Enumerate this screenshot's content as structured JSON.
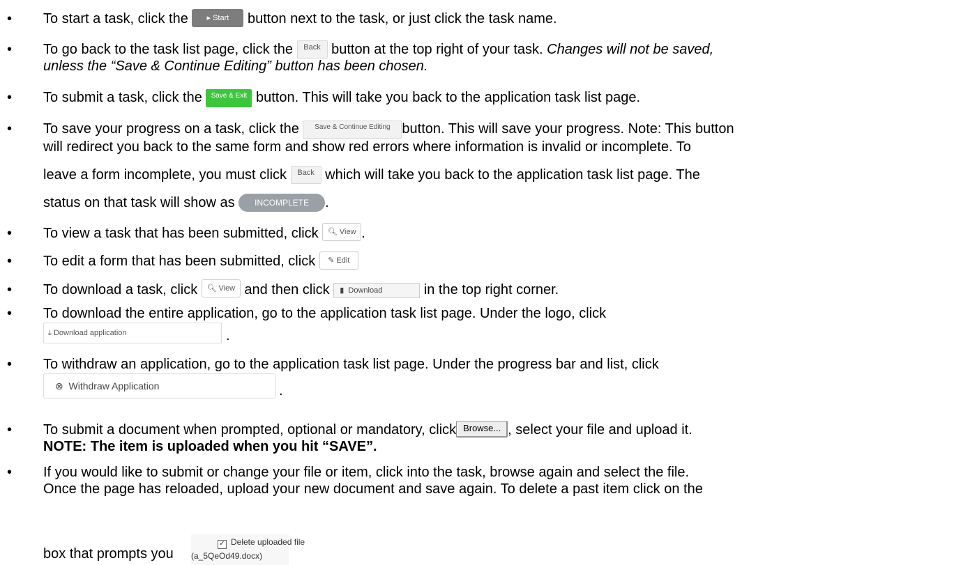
{
  "bullet_char": "•",
  "items": [
    {
      "pre": "To start a task, click the",
      "post": "button next to the task, or just click the task name."
    },
    {
      "pre": "To go back to the task list page, click the",
      "post": "button at the top right of your task.",
      "italic1": "Changes will not be saved,",
      "italic2": "unless the “Save & Continue Editing” button has been chosen."
    },
    {
      "pre": "To submit a task, click the",
      "post": "button. This will take you back to the application task list page."
    },
    {
      "pre": "To save your progress on a task, click the",
      "post": "button. This will save your progress. Note: This button",
      "line2": "will redirect you back to the same form and show red errors where information is invalid or incomplete. To",
      "line3_pre": "leave a form incomplete, you must click",
      "line3_post": "which will take you back to the application task list page. The",
      "line4_pre": "status on that task will show as",
      "line4_post": "."
    },
    {
      "pre": "To view a task that has been submitted, click",
      "post": "."
    },
    {
      "pre": "To edit a form that has been submitted, click"
    },
    {
      "pre": "To download a task, click",
      "mid": "and then click",
      "post": "in the top right corner."
    },
    {
      "pre": "To download the entire application, go to the application task list page. Under the logo, click",
      "post": "."
    },
    {
      "pre": "To withdraw an application, go to the application task list page. Under the progress bar and list, click",
      "post": "."
    },
    {
      "pre": "To submit a document when prompted, optional or mandatory, click",
      "post": ", select your file and upload it.",
      "bold": "NOTE: The item is uploaded when you hit “SAVE”."
    },
    {
      "line1": "If you would like to submit or change your file or item, click into the task, browse again and select the file.",
      "line2": "Once the page has reloaded, upload your new document and save again. To delete a past item click on the",
      "line3": "box that prompts you"
    }
  ],
  "buttons": {
    "start": "▸ Start",
    "back": "Back",
    "save_exit": "Save & Exit",
    "save_continue": "Save & Continue Editing",
    "incomplete": "INCOMPLETE",
    "view": "View",
    "edit": "Edit",
    "download": "Download",
    "download_application": "Download application",
    "withdraw": "Withdraw Application",
    "browse": "Browse...",
    "delete_file_line1": "Delete uploaded file",
    "delete_file_line2": "(a_5QeOd49.docx)"
  },
  "icons": {
    "view": "document-search-icon",
    "edit": "pencil-icon",
    "download": "file-icon",
    "download_application": "download-arrow-icon",
    "withdraw": "circle-x-icon",
    "delete": "checkbox-icon"
  },
  "colors": {
    "start_button": "#7d7d7d",
    "save_exit_button": "#3ec53e",
    "incomplete_badge": "#9aa0a6"
  }
}
